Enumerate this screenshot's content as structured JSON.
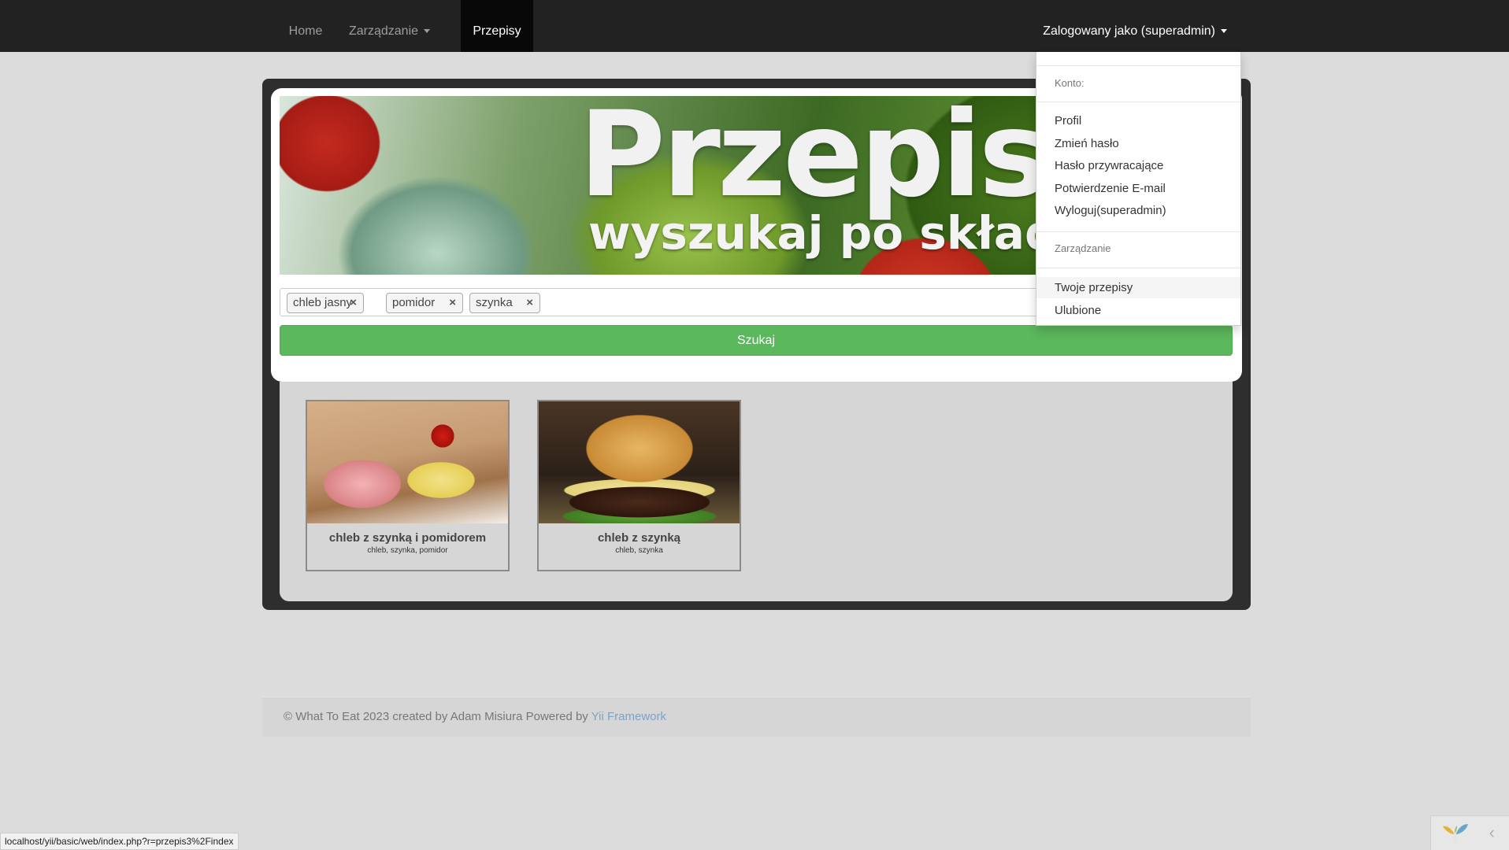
{
  "navbar": {
    "home": "Home",
    "management": "Zarządzanie",
    "recipes": "Przepisy",
    "user_menu": "Zalogowany jako (superadmin)"
  },
  "dropdown": {
    "account_header": "Konto:",
    "profile": "Profil",
    "change_password": "Zmień hasło",
    "reset_password": "Hasło przywracające",
    "email_confirmation": "Potwierdzenie E-mail",
    "logout": "Wyloguj(superadmin)",
    "management_header": "Zarządzanie",
    "your_recipes": "Twoje przepisy",
    "favorites": "Ulubione"
  },
  "banner": {
    "title": "Przepis",
    "subtitle": "wyszukaj po składn"
  },
  "search": {
    "tags": [
      "chleb jasny",
      "pomidor",
      "szynka"
    ],
    "remove_icon": "×",
    "button_label": "Szukaj"
  },
  "recipes": [
    {
      "title": "chleb z szynką i pomidorem",
      "ingredients": "chleb, szynka, pomidor"
    },
    {
      "title": "chleb z szynką",
      "ingredients": "chleb, szynka"
    }
  ],
  "footer": {
    "text": "© What To Eat 2023 created by Adam Misiura Powered by ",
    "link": "Yii Framework"
  },
  "status_bar": {
    "url": "localhost/yii/basic/web/index.php?r=przepis3%2Findex"
  },
  "debug_toolbar": {
    "toggle_icon": "‹"
  },
  "colors": {
    "navbar_bg": "#222222",
    "active_tab_bg": "#080808",
    "search_button": "#5cb85c",
    "footer_link": "#7aa4c8"
  },
  "icons": [
    "caret-down-icon",
    "tag-remove-icon",
    "yii-logo-icon",
    "chevron-left-icon"
  ]
}
